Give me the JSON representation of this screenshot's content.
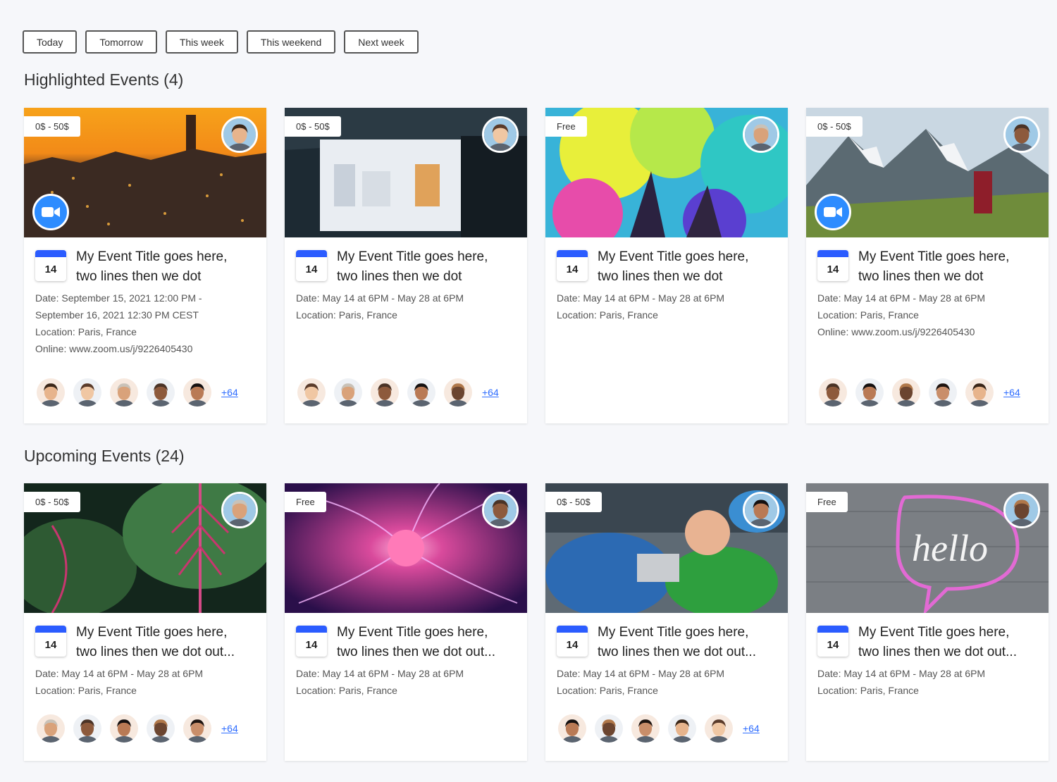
{
  "filters": [
    "Today",
    "Tomorrow",
    "This week",
    "This weekend",
    "Next week"
  ],
  "sections": {
    "highlighted": {
      "title": "Highlighted Events (4)"
    },
    "upcoming": {
      "title": "Upcoming Events (24)"
    }
  },
  "colors": {
    "accent": "#2b5cff",
    "zoom": "#2d8cff",
    "link": "#2d6cff",
    "background": "#f6f7fa"
  },
  "highlighted_events": [
    {
      "price": "0$ - 50$",
      "day": "14",
      "has_zoom": true,
      "title_line1": "My Event Title goes here,",
      "title_line2": "two lines then we dot",
      "date_line1": "Date: September 15, 2021 12:00 PM -",
      "date_line2": "September 16, 2021 12:30 PM CEST",
      "location": "Location: Paris, France",
      "online": "Online:  www.zoom.us/j/9226405430",
      "more": "+64",
      "attendee_count": 5,
      "host_icon": "host-avatar-man"
    },
    {
      "price": "0$ - 50$",
      "day": "14",
      "has_zoom": false,
      "title_line1": "My Event Title goes here,",
      "title_line2": "two lines then we dot",
      "date_line1": "Date: May 14 at 6PM - May 28 at 6PM",
      "date_line2": "",
      "location": "Location: Paris, France",
      "online": "",
      "more": "+64",
      "attendee_count": 5,
      "host_icon": "host-avatar-woman"
    },
    {
      "price": "Free",
      "day": "14",
      "has_zoom": false,
      "title_line1": "My Event Title goes here,",
      "title_line2": "two lines then we dot",
      "date_line1": "Date: May 14 at 6PM - May 28 at 6PM",
      "date_line2": "",
      "location": "Location: Paris, France",
      "online": "",
      "more": "",
      "attendee_count": 0,
      "host_icon": "host-avatar-woman"
    },
    {
      "price": "0$ - 50$",
      "day": "14",
      "has_zoom": true,
      "title_line1": "My Event Title goes here,",
      "title_line2": "two lines then we dot",
      "date_line1": "Date: May 14 at 6PM - May 28 at 6PM",
      "date_line2": "",
      "location": "Location: Paris, France",
      "online": "Online:  www.zoom.us/j/9226405430",
      "more": "+64",
      "attendee_count": 5,
      "host_icon": "host-avatar-man"
    }
  ],
  "upcoming_events": [
    {
      "price": "0$ - 50$",
      "day": "14",
      "title_line1": "My Event Title goes here,",
      "title_line2": "two lines then we dot out...",
      "date_line1": "Date: May 14 at 6PM - May 28 at 6PM",
      "location": "Location: Paris, France",
      "more": "+64",
      "attendee_count": 5
    },
    {
      "price": "Free",
      "day": "14",
      "title_line1": "My Event Title goes here,",
      "title_line2": "two lines then we dot out...",
      "date_line1": "Date: May 14 at 6PM - May 28 at 6PM",
      "location": "Location: Paris, France",
      "more": "",
      "attendee_count": 0
    },
    {
      "price": "0$ - 50$",
      "day": "14",
      "title_line1": "My Event Title goes here,",
      "title_line2": "two lines then we dot out...",
      "date_line1": "Date: May 14 at 6PM - May 28 at 6PM",
      "location": "Location: Paris, France",
      "more": "+64",
      "attendee_count": 5
    },
    {
      "price": "Free",
      "day": "14",
      "title_line1": "My Event Title goes here,",
      "title_line2": "two lines then we dot out...",
      "date_line1": "Date: May 14 at 6PM - May 28 at 6PM",
      "location": "Location: Paris, France",
      "more": "",
      "attendee_count": 0
    }
  ]
}
